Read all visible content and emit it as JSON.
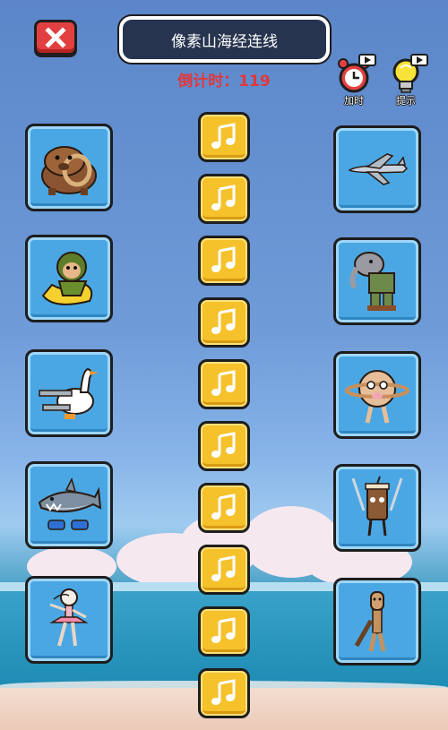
{
  "header": {
    "title": "像素山海经连线",
    "countdown_label": "倒计时：",
    "countdown_value": "119"
  },
  "tools": {
    "add_time_label": "加时",
    "hint_label": "提示"
  },
  "colors": {
    "title_bg": "#26344f",
    "countdown": "#e0383b",
    "card_bg": "#4aa7e3",
    "music_bg": "#f5c22b",
    "close_bg": "#e24040"
  },
  "left_cards": [
    {
      "name": "capybara-with-float-ring",
      "icon": "capybara-icon"
    },
    {
      "name": "monkey-in-banana",
      "icon": "monkey-banana-icon"
    },
    {
      "name": "goose-airplane",
      "icon": "goose-plane-icon"
    },
    {
      "name": "shark-with-sneakers",
      "icon": "shark-sneakers-icon"
    },
    {
      "name": "ballerina-cup-head",
      "icon": "ballerina-icon"
    }
  ],
  "right_cards": [
    {
      "name": "airplane",
      "icon": "airplane-icon"
    },
    {
      "name": "elephant-in-clothes",
      "icon": "elephant-icon"
    },
    {
      "name": "planet-cow",
      "icon": "planet-cow-icon"
    },
    {
      "name": "coffee-cup-with-swords",
      "icon": "coffee-sword-icon"
    },
    {
      "name": "wooden-figure-with-bat",
      "icon": "wood-bat-icon"
    }
  ],
  "music_buttons_count": 10
}
